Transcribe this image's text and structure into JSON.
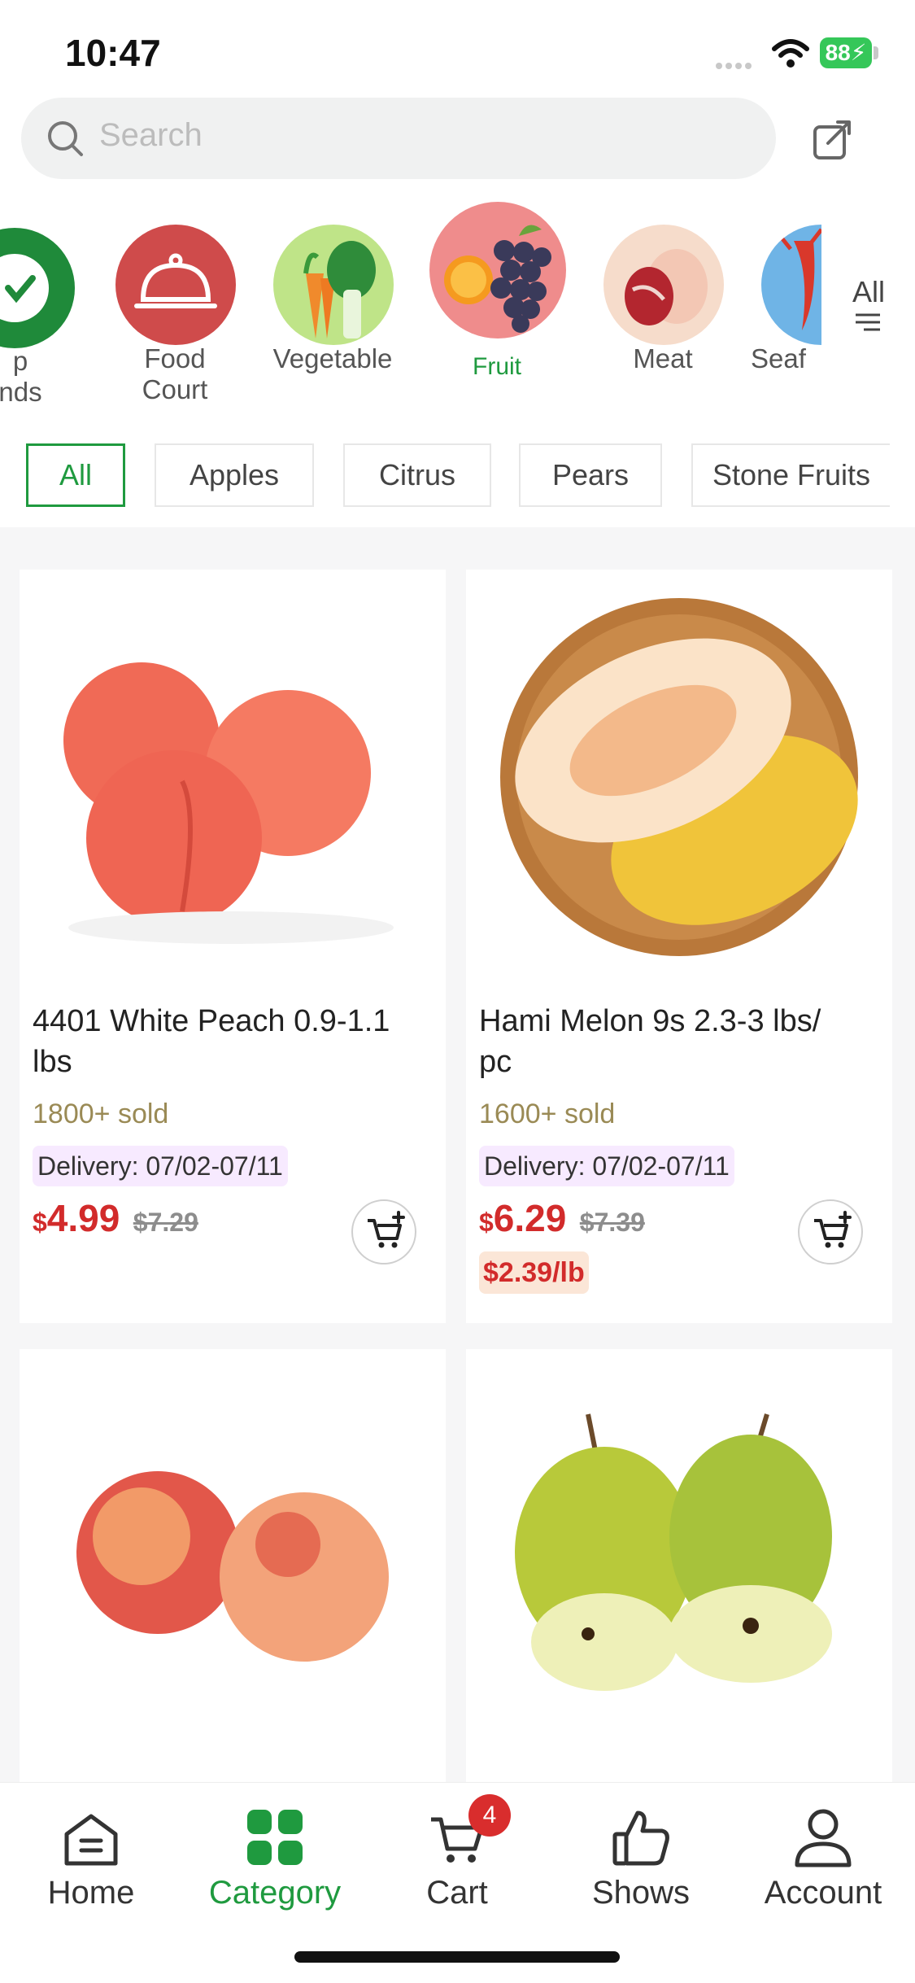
{
  "status": {
    "time": "10:47",
    "battery": "88"
  },
  "search": {
    "placeholder": "Search"
  },
  "categories": [
    {
      "name": "Top Brands",
      "label_line1": "p",
      "label_line2": "nds"
    },
    {
      "name": "Food Court",
      "label_line1": "Food",
      "label_line2": "Court"
    },
    {
      "name": "Vegetable",
      "label_line1": "Vegetable",
      "label_line2": ""
    },
    {
      "name": "Fruit",
      "label_line1": "Fruit",
      "label_line2": "",
      "selected": true
    },
    {
      "name": "Meat",
      "label_line1": "Meat",
      "label_line2": ""
    },
    {
      "name": "Seafood",
      "label_line1": "Seaf",
      "label_line2": ""
    }
  ],
  "all_categories_label": "All",
  "filters": [
    "All",
    "Apples",
    "Citrus",
    "Pears",
    "Stone Fruits"
  ],
  "products": [
    {
      "title_line1": "4401 White Peach 0.9-1.1",
      "title_line2": "lbs",
      "sold": "1800+ sold",
      "delivery": "Delivery: 07/02-07/11",
      "currency": "$",
      "price": "4.99",
      "old_price": "$7.29",
      "unit_price": ""
    },
    {
      "title_line1": "Hami Melon 9s 2.3-3 lbs/",
      "title_line2": "pc",
      "sold": "1600+ sold",
      "delivery": "Delivery: 07/02-07/11",
      "currency": "$",
      "price": "6.29",
      "old_price": "$7.39",
      "unit_price": "$2.39/lb"
    }
  ],
  "nav": {
    "home": "Home",
    "category": "Category",
    "cart": "Cart",
    "shows": "Shows",
    "account": "Account",
    "cart_badge": "4"
  },
  "colors": {
    "accent": "#1f9a3f",
    "price": "#d22b2b",
    "sold": "#9a8a55"
  }
}
